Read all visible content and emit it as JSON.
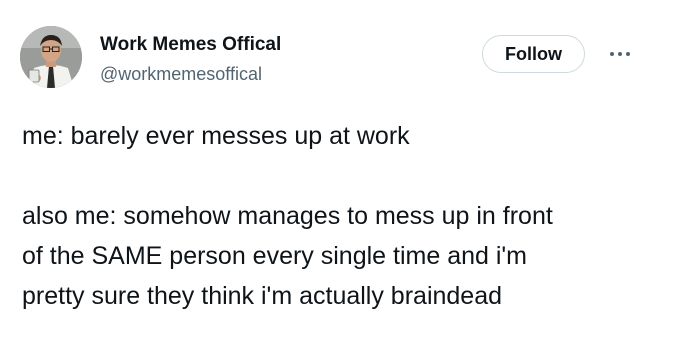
{
  "author": {
    "display_name": "Work Memes Offical",
    "handle": "@workmemesoffical",
    "avatar_icon": "profile-photo-man-with-mug"
  },
  "actions": {
    "follow_label": "Follow",
    "more_icon": "more-horizontal-icon"
  },
  "tweet": {
    "lines": [
      "me: barely ever messes up at work",
      "",
      "also me: somehow manages to mess up in front",
      "of the SAME person every single time and i'm",
      "pretty sure they think i'm actually braindead"
    ]
  },
  "colors": {
    "text": "#0f1419",
    "secondary": "#536471",
    "border": "#cfd9de",
    "background": "#ffffff"
  }
}
